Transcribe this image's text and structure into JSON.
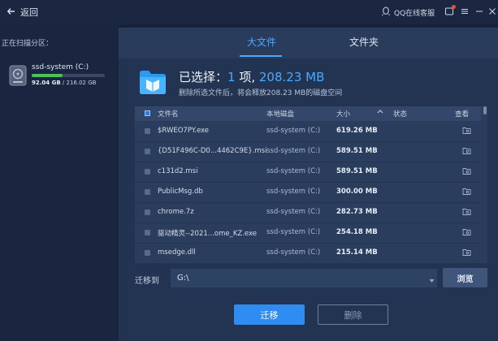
{
  "header": {
    "back_label": "返回",
    "service_label": "QQ在线客服"
  },
  "left": {
    "scan_label": "正在扫描分区：",
    "drive": {
      "name": "ssd-system (C:)",
      "used": "92.04 GB",
      "total": "216.02 GB",
      "used_fraction": 0.426
    }
  },
  "tabs": [
    {
      "label": "大文件",
      "active": true
    },
    {
      "label": "文件夹",
      "active": false
    }
  ],
  "selection": {
    "prefix": "已选择：",
    "count": "1",
    "unit": " 项, ",
    "size": "208.23 MB",
    "description": "删除所选文件后，将会释放208.23 MB的磁盘空间"
  },
  "table": {
    "headers": {
      "name": "文件名",
      "disk": "本地磁盘",
      "size": "大小",
      "status": "状态",
      "view": "查看"
    },
    "rows": [
      {
        "name": "$RWEO7PY.exe",
        "disk": "ssd-system (C:)",
        "size": "619.26 MB"
      },
      {
        "name": "{D51F496C-D0...4462C9E}.msi",
        "disk": "ssd-system (C:)",
        "size": "589.51 MB"
      },
      {
        "name": "c131d2.msi",
        "disk": "ssd-system (C:)",
        "size": "589.51 MB"
      },
      {
        "name": "PublicMsg.db",
        "disk": "ssd-system (C:)",
        "size": "300.00 MB"
      },
      {
        "name": "chrome.7z",
        "disk": "ssd-system (C:)",
        "size": "282.73 MB"
      },
      {
        "name": "驱动精灵--2021...ome_KZ.exe",
        "disk": "ssd-system (C:)",
        "size": "254.18 MB"
      },
      {
        "name": "msedge.dll",
        "disk": "ssd-system (C:)",
        "size": "215.14 MB"
      }
    ]
  },
  "migrate": {
    "label": "迁移到",
    "path_value": "G:\\",
    "browse_label": "浏览",
    "migrate_button": "迁移",
    "delete_button": "删除"
  },
  "colors": {
    "accent": "#4aa8ff",
    "progress": "#4cc05a",
    "button": "#2f8cf0"
  }
}
